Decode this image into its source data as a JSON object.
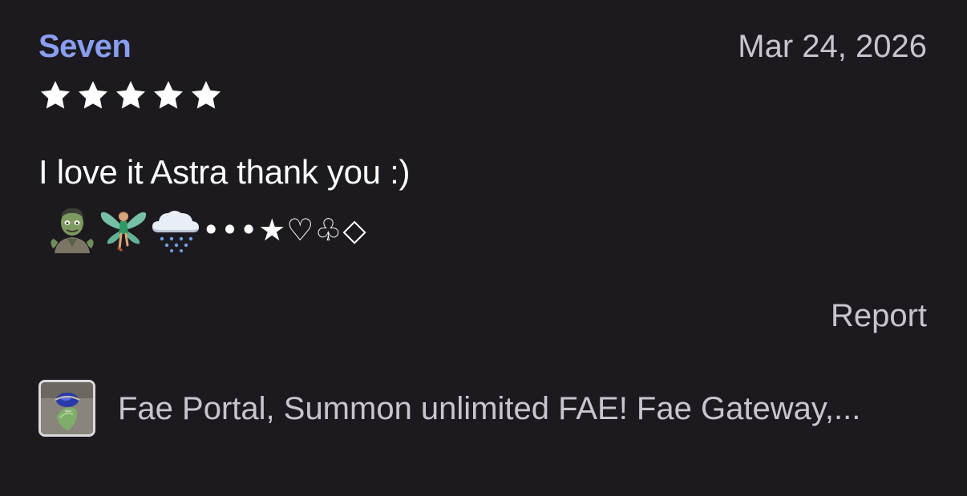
{
  "review": {
    "reviewer_name": "Seven",
    "date": "Mar 24, 2026",
    "rating": 5,
    "rating_max": 5,
    "text": "I love it Astra thank you :)",
    "emojis": [
      "zombie-emoji",
      "fairy-emoji",
      "snow-cloud-emoji"
    ],
    "symbols": "•••★♡♧◇",
    "report_label": "Report"
  },
  "listing": {
    "title": "Fae Portal, Summon unlimited FAE! Fae Gateway,..."
  },
  "colors": {
    "background": "#1c1a1f",
    "reviewer_name": "#8a9ef0",
    "muted_text": "#c9c5cc",
    "star": "#ffffff"
  }
}
